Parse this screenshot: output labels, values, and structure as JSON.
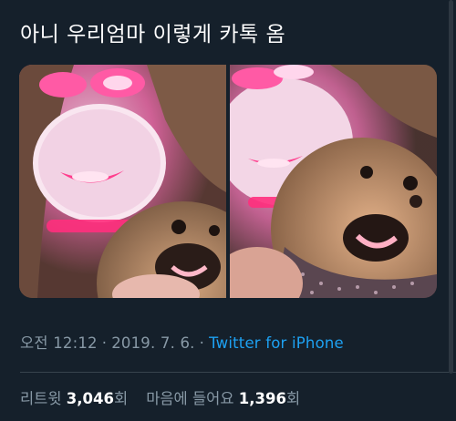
{
  "tweet": {
    "text": "아니 우리엄마 이렇게 카톡 옴"
  },
  "media": {
    "photos": [
      {
        "icon": "photo-woman-led-mask-with-dog"
      },
      {
        "icon": "photo-woman-led-mask-with-dog-close"
      }
    ]
  },
  "meta": {
    "time": "오전 12:12",
    "separator": "·",
    "date": "2019. 7. 6.",
    "source": "Twitter for iPhone"
  },
  "stats": {
    "retweets_label": "리트윗",
    "retweets_count": "3,046",
    "retweets_unit": "회",
    "likes_label": "마음에 들어요",
    "likes_count": "1,396",
    "likes_unit": "회"
  },
  "colors": {
    "background": "#15202b",
    "secondary_text": "#8899a6",
    "link": "#1da1f2",
    "led_pink": "#ff4f9a"
  }
}
